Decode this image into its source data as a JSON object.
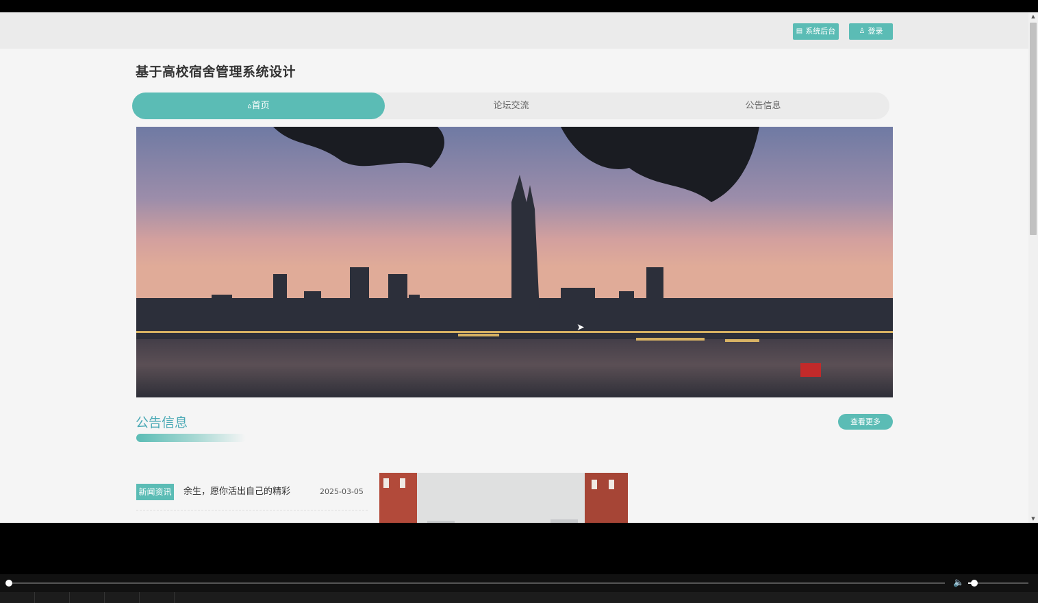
{
  "header": {
    "admin_label": "系统后台",
    "login_label": "登录"
  },
  "site": {
    "title": "基于高校宿舍管理系统设计"
  },
  "nav": {
    "items": [
      {
        "label": "首页"
      },
      {
        "label": "论坛交流"
      },
      {
        "label": "公告信息"
      }
    ]
  },
  "section": {
    "title": "公告信息",
    "more_label": "查看更多"
  },
  "news": [
    {
      "tag": "新闻资讯",
      "title": "余生，愿你活出自己的精彩",
      "date": "2025-03-05"
    }
  ],
  "colors": {
    "accent": "#5bbcb5",
    "section_title": "#4aa9b5"
  },
  "icons": {
    "admin": "book-icon",
    "login": "user-icon",
    "home": "home-icon"
  },
  "player": {
    "progress": 0,
    "volume": 0.1
  }
}
